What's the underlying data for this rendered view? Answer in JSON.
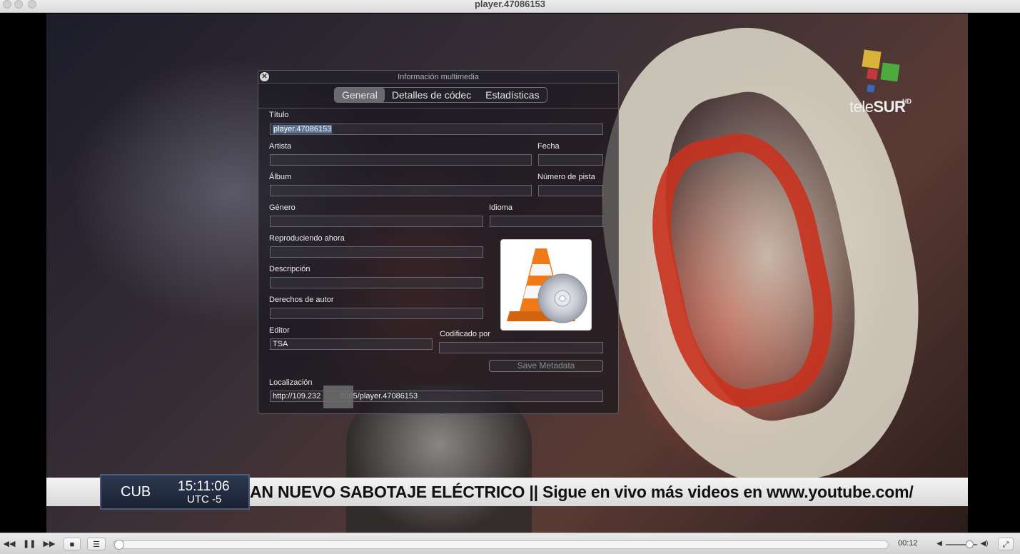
{
  "window": {
    "title": "player.47086153"
  },
  "video": {
    "logo_main": "tele",
    "logo_bold": "SUR",
    "logo_hd": "HD",
    "ticker_text": "AN NUEVO SABOTAJE ELÉCTRICO || Sigue en vivo más videos en www.youtube.com/",
    "country": "CUB",
    "clock": "15:11:06",
    "tz": "UTC -5"
  },
  "dialog": {
    "title": "Información multimedia",
    "tabs": [
      "General",
      "Detalles de códec",
      "Estadísticas"
    ],
    "labels": {
      "title": "Título",
      "artist": "Artista",
      "date": "Fecha",
      "album": "Álbum",
      "track": "Número de pista",
      "genre": "Género",
      "language": "Idioma",
      "now_playing": "Reproduciendo ahora",
      "description": "Descripción",
      "copyright": "Derechos de autor",
      "publisher": "Editor",
      "encoded_by": "Codificado por",
      "location": "Localización"
    },
    "values": {
      "title": "player.47086153",
      "artist": "",
      "date": "",
      "album": "",
      "track": "",
      "genre": "",
      "language": "",
      "now_playing": "",
      "description": "",
      "copyright": "",
      "publisher": "TSA",
      "encoded_by": "",
      "location_a": "http://109.232",
      "location_b": "8085/player.47086153"
    },
    "save_label": "Save Metadata"
  },
  "controls": {
    "rewind": "◀◀",
    "pause": "❚❚",
    "forward": "▶▶",
    "stop": "■",
    "playlist": "☰",
    "time": "00:12",
    "progress": 0.0,
    "volume": 0.75,
    "fullscreen": "⤢"
  },
  "icons": {
    "close": "close-icon",
    "art": "vlc-cone-icon"
  }
}
